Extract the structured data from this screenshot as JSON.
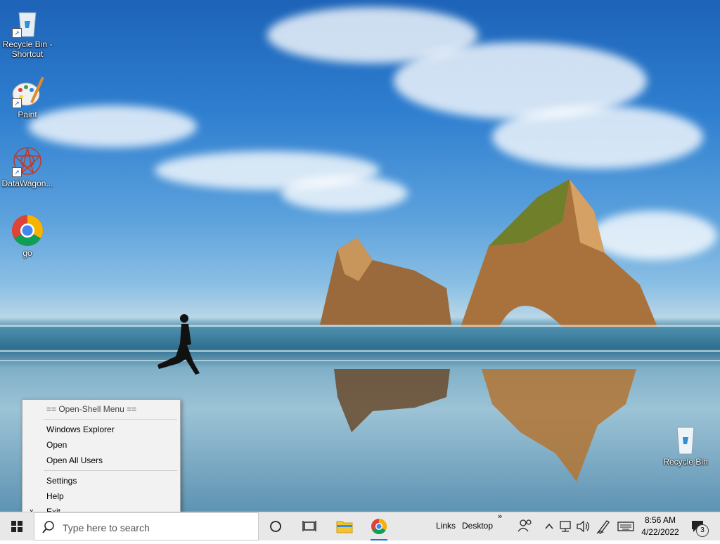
{
  "desktop_icons": [
    {
      "label": "Recycle Bin - Shortcut",
      "icon": "recycle-bin-icon"
    },
    {
      "label": "Paint",
      "icon": "paint-icon"
    },
    {
      "label": "DataWagon...",
      "icon": "datawagon-icon"
    },
    {
      "label": "go",
      "icon": "chrome-icon"
    },
    {
      "label": "Recycle Bin",
      "icon": "recycle-bin-icon"
    }
  ],
  "context_menu": {
    "title": "== Open-Shell Menu ==",
    "items": [
      "Windows Explorer",
      "Open",
      "Open All Users",
      "Settings",
      "Help",
      "Exit"
    ],
    "exit_mark": "x"
  },
  "taskbar": {
    "search_placeholder": "Type here to search",
    "links_label": "Links",
    "desktop_label": "Desktop",
    "overflow": "»",
    "time": "8:56 AM",
    "date": "4/22/2022",
    "notification_count": "3"
  },
  "colors": {
    "accent_blue": "#1a73e8",
    "folder_yellow": "#f4c430"
  }
}
